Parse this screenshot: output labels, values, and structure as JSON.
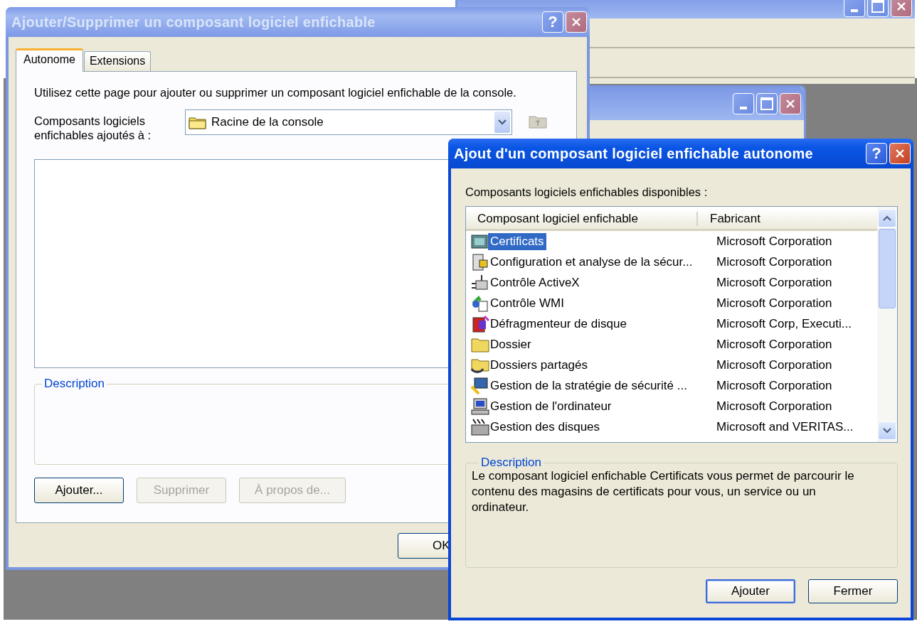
{
  "main_dialog": {
    "title": "Ajouter/Supprimer un composant logiciel enfichable",
    "active": false,
    "help_button": "?",
    "tabs": [
      {
        "label": "Autonome",
        "selected": true
      },
      {
        "label": "Extensions",
        "selected": false
      }
    ],
    "intro": "Utilisez cette page pour ajouter ou supprimer un composant logiciel enfichable de la console.",
    "target_label": "Composants logiciels enfichables ajoutés à :",
    "target_value": "Racine de la console",
    "description_legend": "Description",
    "buttons": [
      {
        "label": "Ajouter...",
        "disabled": false
      },
      {
        "label": "Supprimer",
        "disabled": true
      },
      {
        "label": "À propos de...",
        "disabled": true
      }
    ],
    "ok_button": "OK"
  },
  "add_dialog": {
    "title": "Ajout d'un composant logiciel enfichable autonome",
    "active": true,
    "help_button": "?",
    "list_label": "Composants logiciels enfichables disponibles :",
    "columns": [
      "Composant logiciel enfichable",
      "Fabricant"
    ],
    "rows": [
      {
        "kind": "certificate",
        "name": "Certificats",
        "vendor": "Microsoft Corporation",
        "selected": true
      },
      {
        "kind": "security",
        "name": "Configuration et analyse de la sécur...",
        "vendor": "Microsoft Corporation",
        "selected": false
      },
      {
        "kind": "activex",
        "name": "Contrôle ActiveX",
        "vendor": "Microsoft Corporation",
        "selected": false
      },
      {
        "kind": "wmi",
        "name": "Contrôle WMI",
        "vendor": "Microsoft Corporation",
        "selected": false
      },
      {
        "kind": "defrag",
        "name": "Défragmenteur de disque",
        "vendor": "Microsoft Corp, Executi...",
        "selected": false
      },
      {
        "kind": "folder",
        "name": "Dossier",
        "vendor": "Microsoft Corporation",
        "selected": false
      },
      {
        "kind": "shared",
        "name": "Dossiers partagés",
        "vendor": "Microsoft Corporation",
        "selected": false
      },
      {
        "kind": "policy",
        "name": "Gestion de la stratégie de sécurité ...",
        "vendor": "Microsoft Corporation",
        "selected": false
      },
      {
        "kind": "computer",
        "name": "Gestion de l'ordinateur",
        "vendor": "Microsoft Corporation",
        "selected": false
      },
      {
        "kind": "disks",
        "name": "Gestion des disques",
        "vendor": "Microsoft and VERITAS...",
        "selected": false
      }
    ],
    "description_legend": "Description",
    "description": "Le composant logiciel enfichable Certificats vous permet de parcourir le contenu des magasins de certificats pour vous, un service ou un ordinateur.",
    "buttons": [
      {
        "label": "Ajouter",
        "default": true
      },
      {
        "label": "Fermer",
        "default": false
      }
    ]
  }
}
